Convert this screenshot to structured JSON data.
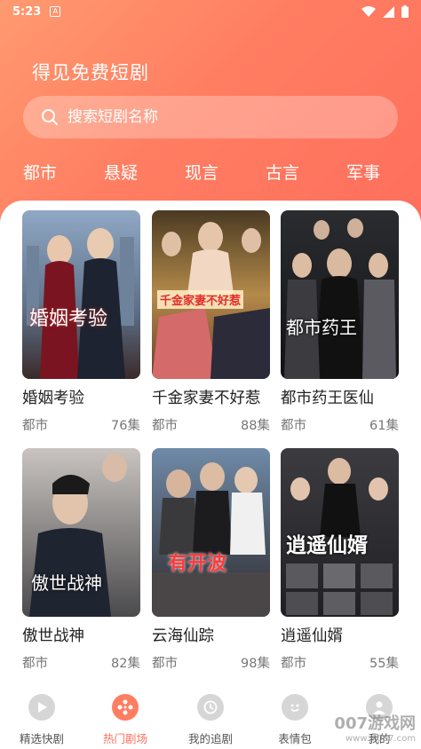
{
  "status": {
    "time": "5:23",
    "notif_icon": "A"
  },
  "header": {
    "title": "得见免费短剧"
  },
  "search": {
    "placeholder": "搜索短剧名称"
  },
  "categories": [
    "都市",
    "悬疑",
    "现言",
    "古言",
    "军事"
  ],
  "dramas": [
    {
      "title": "婚姻考验",
      "genre": "都市",
      "episodes": "76集",
      "poster_text": "婚姻考验"
    },
    {
      "title": "千金家妻不好惹",
      "genre": "都市",
      "episodes": "88集",
      "poster_text": "千金家妻不好惹"
    },
    {
      "title": "都市药王医仙",
      "genre": "都市",
      "episodes": "61集",
      "poster_text": "都市药王"
    },
    {
      "title": "傲世战神",
      "genre": "都市",
      "episodes": "82集",
      "poster_text": "傲世战神"
    },
    {
      "title": "云海仙踪",
      "genre": "都市",
      "episodes": "98集",
      "poster_text": "有开波"
    },
    {
      "title": "逍遥仙婿",
      "genre": "都市",
      "episodes": "55集",
      "poster_text": "逍遥仙婿"
    }
  ],
  "tabs": [
    {
      "label": "精选快剧",
      "icon": "play-icon"
    },
    {
      "label": "热门剧场",
      "icon": "film-reel-icon",
      "active": true
    },
    {
      "label": "我的追剧",
      "icon": "clock-icon"
    },
    {
      "label": "表情包",
      "icon": "smiley-icon"
    },
    {
      "label": "我的",
      "icon": "user-icon"
    }
  ],
  "watermark": {
    "text": "007游戏网",
    "url": "www.jk007.com"
  },
  "colors": {
    "accent": "#ff7e62",
    "header_start": "#ff9a70",
    "header_end": "#ff6e5c"
  }
}
